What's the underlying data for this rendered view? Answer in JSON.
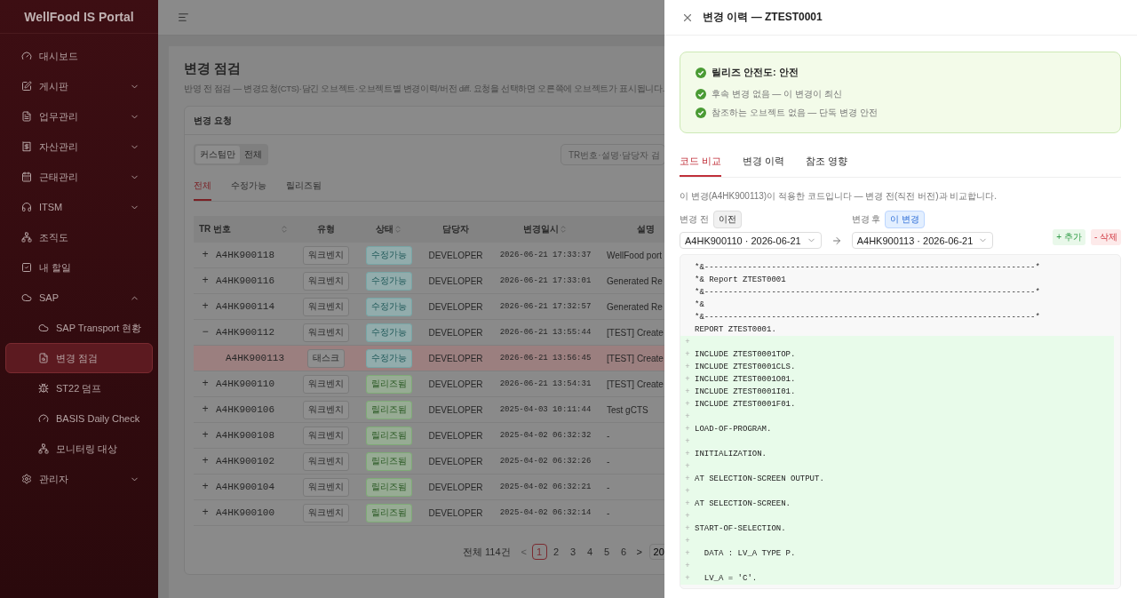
{
  "sidebar": {
    "title": "WellFood IS Portal",
    "items": [
      {
        "label": "대시보드",
        "selected": false
      },
      {
        "label": "게시판",
        "selected": false,
        "expanded": false
      },
      {
        "label": "업무관리",
        "selected": false,
        "expanded": false
      },
      {
        "label": "자산관리",
        "selected": false,
        "expanded": false
      },
      {
        "label": "근태관리",
        "selected": false,
        "expanded": false
      },
      {
        "label": "ITSM",
        "selected": false,
        "expanded": false
      },
      {
        "label": "조직도",
        "selected": false
      },
      {
        "label": "내 할일",
        "selected": false
      },
      {
        "label": "SAP",
        "selected": false,
        "expanded": true,
        "children": [
          {
            "label": "SAP Transport 현황",
            "selected": false
          },
          {
            "label": "변경 점검",
            "selected": true
          },
          {
            "label": "ST22 덤프",
            "selected": false
          },
          {
            "label": "BASIS Daily Check",
            "selected": false
          },
          {
            "label": "모니터링 대상",
            "selected": false
          }
        ]
      },
      {
        "label": "관리자",
        "selected": false,
        "expanded": false
      }
    ]
  },
  "page": {
    "title": "변경 점검",
    "subtitle": "반영 전 점검 — 변경요청(CTS)·담긴 오브젝트·오브젝트별 변경이력/버전 diff. 요청을 선택하면 오른쪽에 오브젝트가 표시됩니다.",
    "card": {
      "title": "변경 요청",
      "filters": [
        {
          "label": "커스텀만",
          "selected": true
        },
        {
          "label": "전체",
          "selected": false
        }
      ],
      "search": {
        "placeholder": "TR번호·설명·담당자 검"
      },
      "tabs": [
        {
          "label": "전체",
          "selected": true
        },
        {
          "label": "수정가능",
          "selected": false
        },
        {
          "label": "릴리즈됨",
          "selected": false
        }
      ],
      "table": {
        "columns": [
          {
            "label": "TR 번호",
            "sortable": true
          },
          {
            "label": "유형",
            "sortable": false
          },
          {
            "label": "상태",
            "sortable": true
          },
          {
            "label": "담당자",
            "sortable": false
          },
          {
            "label": "변경일시",
            "sortable": true
          },
          {
            "label": "설명",
            "sortable": false
          }
        ],
        "rows": [
          {
            "toggle": "+",
            "tr": "A4HK900118",
            "type": "워크벤치",
            "status": {
              "label": "수정가능",
              "kind": "editable"
            },
            "owner": "DEVELOPER",
            "date": "2026-06-21 17:33:37",
            "desc": "WellFood port",
            "selected": false
          },
          {
            "toggle": "+",
            "tr": "A4HK900116",
            "type": "워크벤치",
            "status": {
              "label": "수정가능",
              "kind": "editable"
            },
            "owner": "DEVELOPER",
            "date": "2026-06-21 17:33:01",
            "desc": "Generated Re",
            "selected": false
          },
          {
            "toggle": "+",
            "tr": "A4HK900114",
            "type": "워크벤치",
            "status": {
              "label": "수정가능",
              "kind": "editable"
            },
            "owner": "DEVELOPER",
            "date": "2026-06-21 17:32:57",
            "desc": "Generated Re",
            "selected": false
          },
          {
            "toggle": "−",
            "tr": "A4HK900112",
            "type": "워크벤치",
            "status": {
              "label": "수정가능",
              "kind": "editable"
            },
            "owner": "DEVELOPER",
            "date": "2026-06-21 13:55:44",
            "desc": "[TEST] Create",
            "selected": false,
            "children": [
              {
                "tr": "A4HK900113",
                "type": "태스크",
                "status": {
                  "label": "수정가능",
                  "kind": "editable"
                },
                "owner": "DEVELOPER",
                "date": "2026-06-21 13:56:45",
                "desc": "[TEST] Create",
                "selected": true
              }
            ]
          },
          {
            "toggle": "+",
            "tr": "A4HK900110",
            "type": "워크벤치",
            "status": {
              "label": "릴리즈됨",
              "kind": "released"
            },
            "owner": "DEVELOPER",
            "date": "2026-06-21 13:54:31",
            "desc": "[TEST] Create",
            "selected": false
          },
          {
            "toggle": "+",
            "tr": "A4HK900106",
            "type": "워크벤치",
            "status": {
              "label": "릴리즈됨",
              "kind": "released"
            },
            "owner": "DEVELOPER",
            "date": "2025-04-03 10:11:44",
            "desc": "Test gCTS",
            "selected": false
          },
          {
            "toggle": "+",
            "tr": "A4HK900108",
            "type": "워크벤치",
            "status": {
              "label": "릴리즈됨",
              "kind": "released"
            },
            "owner": "DEVELOPER",
            "date": "2025-04-02 06:32:32",
            "desc": "-",
            "selected": false
          },
          {
            "toggle": "+",
            "tr": "A4HK900102",
            "type": "워크벤치",
            "status": {
              "label": "릴리즈됨",
              "kind": "released"
            },
            "owner": "DEVELOPER",
            "date": "2025-04-02 06:32:26",
            "desc": "-",
            "selected": false
          },
          {
            "toggle": "+",
            "tr": "A4HK900104",
            "type": "워크벤치",
            "status": {
              "label": "릴리즈됨",
              "kind": "released"
            },
            "owner": "DEVELOPER",
            "date": "2025-04-02 06:32:21",
            "desc": "-",
            "selected": false
          },
          {
            "toggle": "+",
            "tr": "A4HK900100",
            "type": "워크벤치",
            "status": {
              "label": "릴리즈됨",
              "kind": "released"
            },
            "owner": "DEVELOPER",
            "date": "2025-04-02 06:32:14",
            "desc": "-",
            "selected": false
          }
        ]
      },
      "pagination": {
        "total": "전체 114건",
        "prev": {
          "label": "<",
          "disabled": true
        },
        "pages": [
          {
            "label": "1",
            "selected": true
          },
          {
            "label": "2",
            "selected": false
          },
          {
            "label": "3",
            "selected": false
          },
          {
            "label": "4",
            "selected": false
          },
          {
            "label": "5",
            "selected": false
          },
          {
            "label": "6",
            "selected": false
          }
        ],
        "next": {
          "label": ">",
          "disabled": false
        },
        "page_size": "20"
      }
    }
  },
  "drawer": {
    "title": "변경 이력 — ZTEST0001",
    "safety": {
      "title": "릴리즈 안전도: 안전",
      "items": [
        "후속 변경 없음 — 이 변경이 최신",
        "참조하는 오브젝트 없음 — 단독 변경 안전"
      ]
    },
    "tabs": [
      {
        "label": "코드 비교",
        "selected": true
      },
      {
        "label": "변경 이력",
        "selected": false
      },
      {
        "label": "참조 영향",
        "selected": false
      }
    ],
    "description": "이 변경(A4HK900113)이 적용한 코드입니다 — 변경 전(직전 버전)과 비교합니다.",
    "before": {
      "label": "변경 전",
      "tag": "이전",
      "value": "A4HK900110 · 2026-06-21"
    },
    "after": {
      "label": "변경 후",
      "tag": "이 변경",
      "value": "A4HK900113 · 2026-06-21"
    },
    "legend": [
      {
        "kind": "added",
        "label": "+ 추가"
      },
      {
        "kind": "removed",
        "label": "- 삭제"
      }
    ],
    "code": [
      {
        "kind": "context",
        "text": "*&---------------------------------------------------------------------*"
      },
      {
        "kind": "context",
        "text": "*& Report ZTEST0001"
      },
      {
        "kind": "context",
        "text": "*&---------------------------------------------------------------------*"
      },
      {
        "kind": "context",
        "text": "*&"
      },
      {
        "kind": "context",
        "text": "*&---------------------------------------------------------------------*"
      },
      {
        "kind": "context",
        "text": "REPORT ZTEST0001."
      },
      {
        "kind": "added",
        "marker": "+"
      },
      {
        "kind": "added",
        "marker": "+",
        "text": "INCLUDE ZTEST0001TOP."
      },
      {
        "kind": "added",
        "marker": "+",
        "text": "INCLUDE ZTEST0001CLS."
      },
      {
        "kind": "added",
        "marker": "+",
        "text": "INCLUDE ZTEST0001O01."
      },
      {
        "kind": "added",
        "marker": "+",
        "text": "INCLUDE ZTEST0001I01."
      },
      {
        "kind": "added",
        "marker": "+",
        "text": "INCLUDE ZTEST0001F01."
      },
      {
        "kind": "added",
        "marker": "+"
      },
      {
        "kind": "added",
        "marker": "+",
        "text": "LOAD-OF-PROGRAM."
      },
      {
        "kind": "added",
        "marker": "+"
      },
      {
        "kind": "added",
        "marker": "+",
        "text": "INITIALIZATION."
      },
      {
        "kind": "added",
        "marker": "+"
      },
      {
        "kind": "added",
        "marker": "+",
        "text": "AT SELECTION-SCREEN OUTPUT."
      },
      {
        "kind": "added",
        "marker": "+"
      },
      {
        "kind": "added",
        "marker": "+",
        "text": "AT SELECTION-SCREEN."
      },
      {
        "kind": "added",
        "marker": "+"
      },
      {
        "kind": "added",
        "marker": "+",
        "text": "START-OF-SELECTION."
      },
      {
        "kind": "added",
        "marker": "+"
      },
      {
        "kind": "added",
        "marker": "+",
        "text": "  DATA : LV_A TYPE P."
      },
      {
        "kind": "added",
        "marker": "+"
      },
      {
        "kind": "added",
        "marker": "+",
        "text": "  LV_A = 'C'."
      }
    ]
  }
}
